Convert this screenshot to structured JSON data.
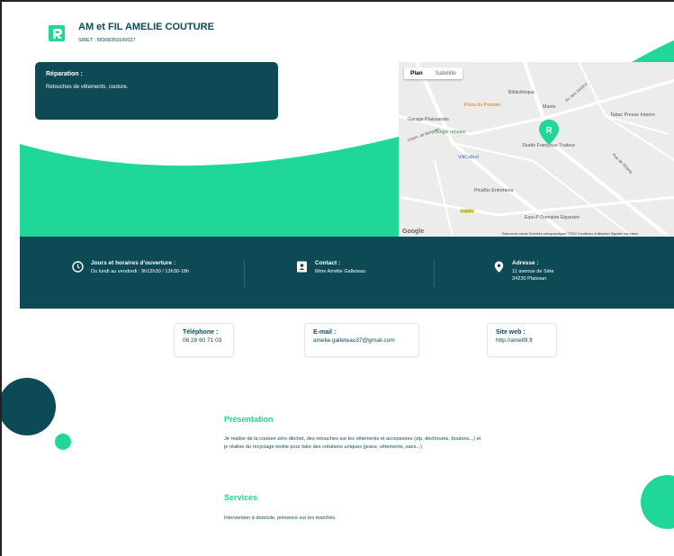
{
  "header": {
    "title": "AM et FIL AMELIE COUTURE",
    "siret": "SIRET : 88368359100027"
  },
  "repair": {
    "title": "Réparation :",
    "text": "Retouches de vêtements, couture."
  },
  "map": {
    "tabs": [
      "Plan",
      "Satellite"
    ],
    "labels": [
      "Bibliothèque",
      "Pizza du Portalet",
      "Mairie",
      "Tabac Presse Interim",
      "Garage Plaissanais",
      "Jungle urbaine",
      "Studio Françoise Traiteur",
      "VitiCabrol",
      "PinsBio Entretiens",
      "Equi-P Domaine Equestre",
      "Av. des Jardins",
      "Chem. de Bergues",
      "Rue de l'Étang",
      "D185E1"
    ],
    "footer": "Raccourcis clavier   Données cartographiques ©2022   Conditions d'utilisation   Signaler une erreur",
    "google": "Google"
  },
  "info": {
    "hours_title": "Jours et horaires d'ouverture :",
    "hours_text": "Du lundi au vendredi : 9h12h30 / 13h30-18h",
    "contact_title": "Contact :",
    "contact_text": "Mme Amélie Galleteau",
    "address_title": "Adresse :",
    "address_line1": "11 avenue de Sète",
    "address_line2": "34230 Plaissan"
  },
  "contacts": {
    "phone_label": "Téléphone :",
    "phone_value": "06 28 60 71 03",
    "email_label": "E-mail :",
    "email_value": "amelie.galleteau37@gmail.com",
    "website_label": "Site web :",
    "website_value": "http://ametfil.fr"
  },
  "presentation": {
    "title": "Présentation",
    "text": "Je réalise de la couture zéro déchet, des retouches sur les vêtements et accessoires (zip, déchirures, boutons...) et je réalise du recyclage textile pour faire des créations uniques (jeans, vêtements, sacs...)"
  },
  "services": {
    "title": "Services",
    "text": "Intervention à domicile, présence sur les marchés."
  },
  "colors": {
    "teal": "#0c4a55",
    "green": "#1ed799"
  }
}
